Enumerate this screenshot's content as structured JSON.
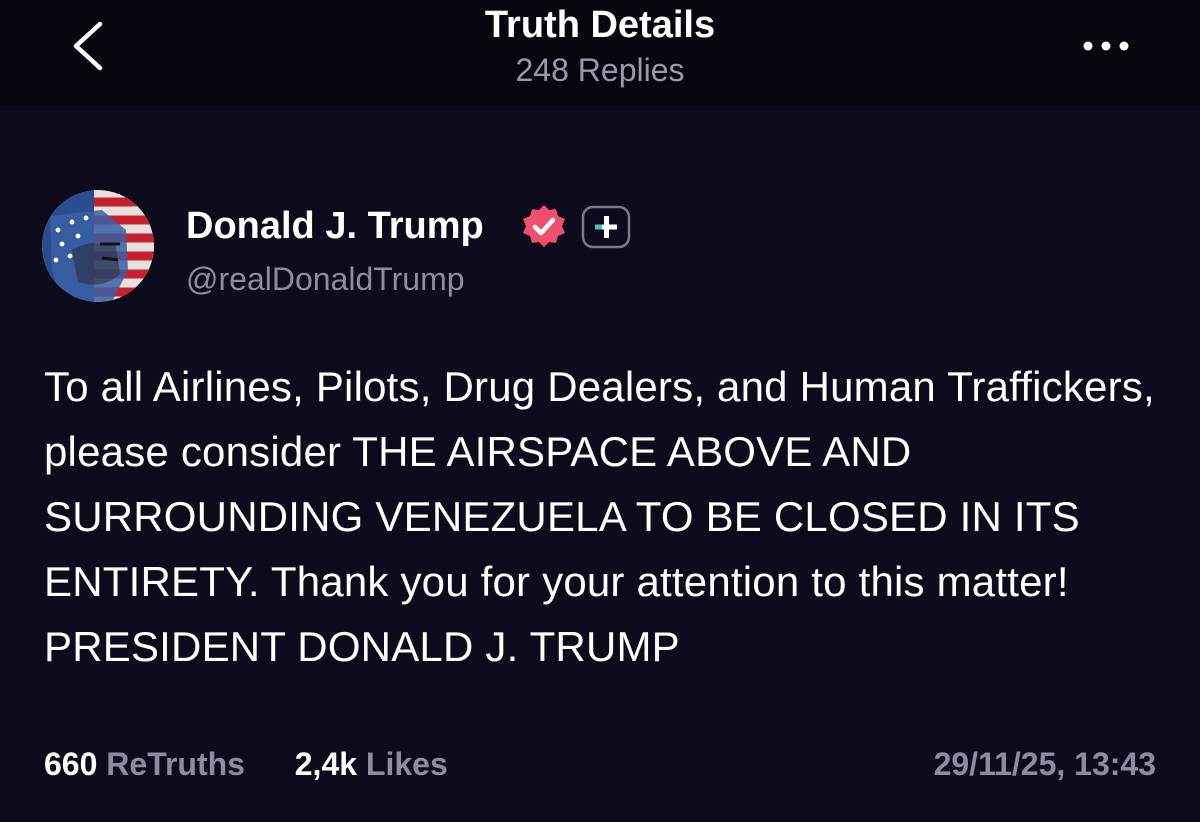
{
  "header": {
    "title": "Truth Details",
    "subtitle": "248 Replies",
    "back_icon": "chevron-left-icon",
    "more_icon": "more-horizontal-icon"
  },
  "post": {
    "author_name": "Donald J. Trump",
    "handle": "@realDonaldTrump",
    "verified_icon": "verified-badge-icon",
    "verified_color": "#f0506e",
    "plus_icon": "plus-badge-icon",
    "body": "To all Airlines, Pilots, Drug Dealers, and Human Traffickers, please consider THE AIRSPACE ABOVE AND SURROUNDING VENEZUELA TO BE CLOSED IN ITS ENTIRETY. Thank you for your attention to this matter! PRESIDENT DONALD J. TRUMP",
    "retruths_count": "660",
    "retruths_label": "ReTruths",
    "likes_count": "2,4k",
    "likes_label": "Likes",
    "timestamp": "29/11/25, 13:43"
  },
  "colors": {
    "background": "#0c0a1b",
    "topbar": "#07060f",
    "muted_text": "#8e8ca0",
    "accent": "#f0506e"
  }
}
